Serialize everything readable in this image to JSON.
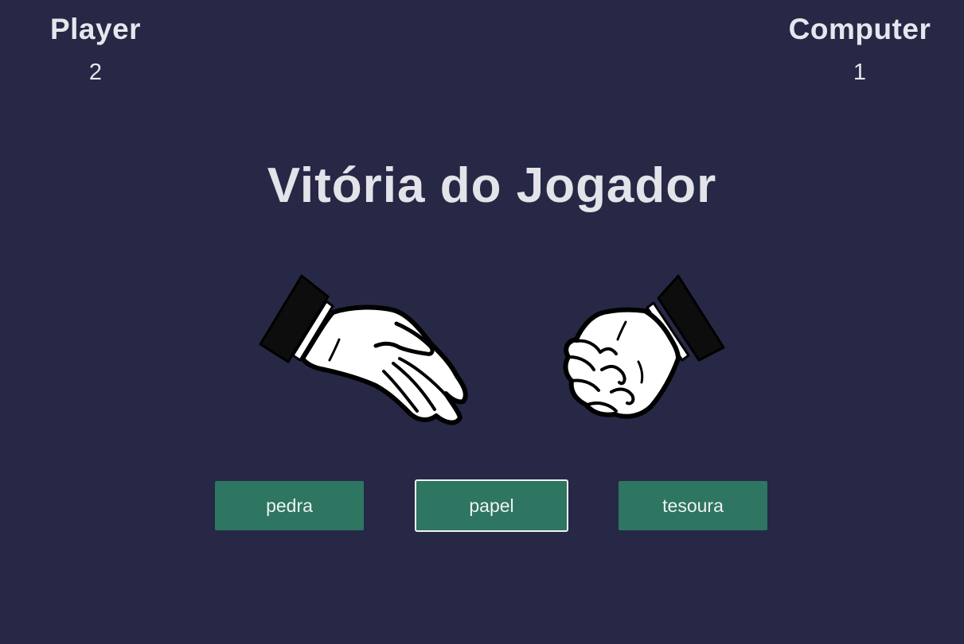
{
  "scoreboard": {
    "player": {
      "label": "Player",
      "score": "2"
    },
    "computer": {
      "label": "Computer",
      "score": "1"
    }
  },
  "result_text": "Vitória do Jogador",
  "hands": {
    "player": "open-hand-paper-icon",
    "computer": "fist-rock-icon"
  },
  "choices": [
    {
      "label": "pedra",
      "focused": false
    },
    {
      "label": "papel",
      "focused": true
    },
    {
      "label": "tesoura",
      "focused": false
    }
  ],
  "colors": {
    "background": "#262845",
    "button": "#2e7562",
    "text": "#e6e6ee"
  }
}
